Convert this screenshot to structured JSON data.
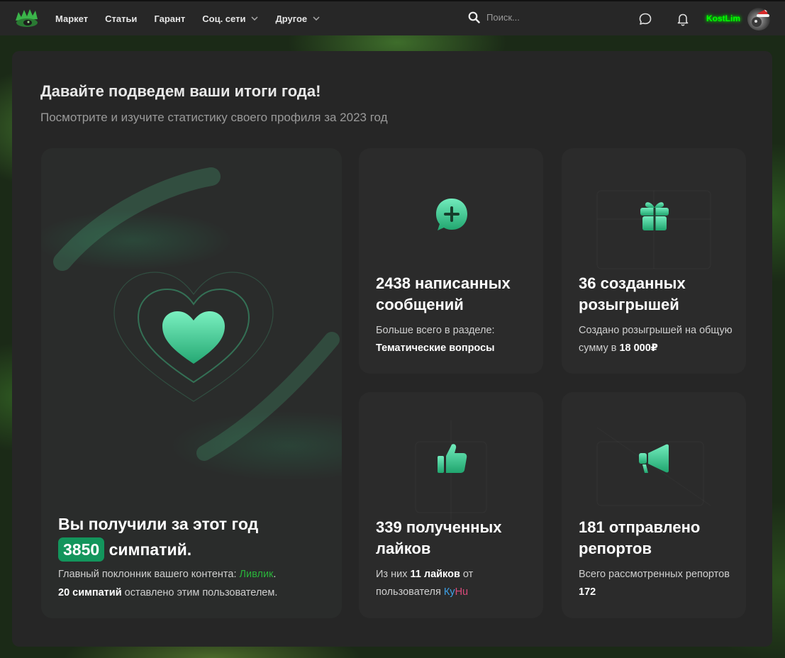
{
  "nav": {
    "items": [
      {
        "label": "Маркет",
        "dropdown": false
      },
      {
        "label": "Статьи",
        "dropdown": false
      },
      {
        "label": "Гарант",
        "dropdown": false
      },
      {
        "label": "Соц. сети",
        "dropdown": true
      },
      {
        "label": "Другое",
        "dropdown": true
      }
    ],
    "search_placeholder": "Поиск...",
    "username": "KostLim",
    "icons": [
      "search-icon",
      "chat-icon",
      "bell-icon"
    ]
  },
  "colors": {
    "accent": "#13955c",
    "username": "#00ff00",
    "link_green": "#29b33a"
  },
  "panel": {
    "title": "Давайте подведем ваши итоги года!",
    "subtitle": "Посмотрите и изучите статистику своего профиля за 2023 год"
  },
  "likes_card": {
    "title_before": "Вы получили за этот год",
    "count": "3850",
    "title_after": "симпатий.",
    "fan_prefix": "Главный поклонник вашего контента:",
    "fan_name": "Ливлик",
    "fan_suffix": ".",
    "fan_count": "20 симпатий",
    "fan_count_suffix": "оставлено этим пользователем."
  },
  "messages_card": {
    "title": "2438 написанных сообщений",
    "text_prefix": "Больше всего в разделе:",
    "text_bold": "Тематические вопросы"
  },
  "giveaways_card": {
    "title": "36 созданных розыгрышей",
    "text_prefix": "Создано розыгрышей на общую сумму в",
    "text_bold": "18 000₽"
  },
  "received_likes_card": {
    "title": "339 полученных лайков",
    "text_prefix": "Из них",
    "text_bold": "11 лайков",
    "text_middle": "от пользователя",
    "nick_part1": "Ку",
    "nick_part2": "Hu"
  },
  "reports_card": {
    "title": "181 отправлено репортов",
    "text_prefix": "Всего рассмотренных репортов",
    "text_bold": "172"
  }
}
